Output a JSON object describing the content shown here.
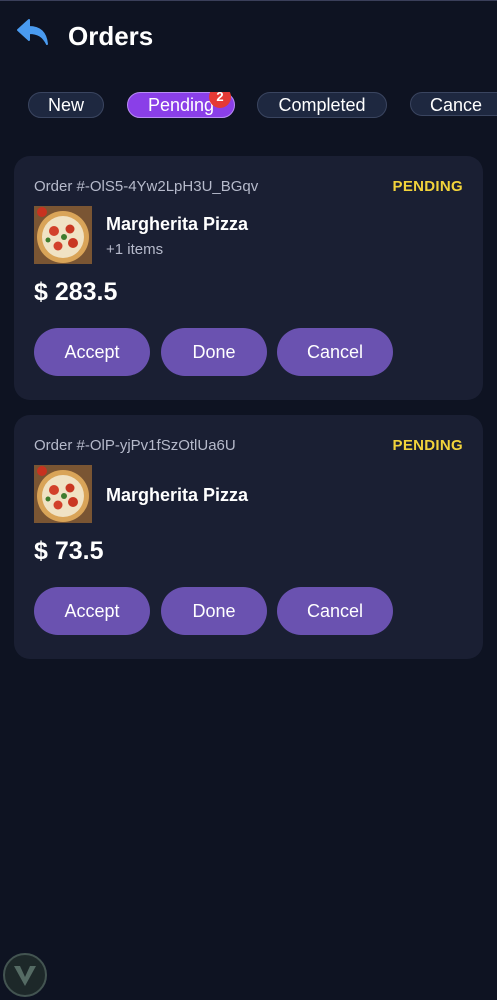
{
  "header": {
    "title": "Orders",
    "back_icon": "back-arrow-icon"
  },
  "tabs": [
    {
      "label": "New",
      "active": false
    },
    {
      "label": "Pending",
      "active": true,
      "badge": "2"
    },
    {
      "label": "Completed",
      "active": false
    },
    {
      "label": "Cance",
      "active": false
    }
  ],
  "orders": [
    {
      "order_id": "Order #-OlS5-4Yw2LpH3U_BGqv",
      "status": "PENDING",
      "product_name": "Margherita Pizza",
      "extra_items": "+1 items",
      "price": "$ 283.5",
      "actions": {
        "accept": "Accept",
        "done": "Done",
        "cancel": "Cancel"
      }
    },
    {
      "order_id": "Order #-OlP-yjPv1fSzOtlUa6U",
      "status": "PENDING",
      "product_name": "Margherita Pizza",
      "extra_items": "",
      "price": "$ 73.5",
      "actions": {
        "accept": "Accept",
        "done": "Done",
        "cancel": "Cancel"
      }
    }
  ],
  "colors": {
    "background": "#0e1322",
    "card": "#1a1f33",
    "accent_tab": "#8a3fe8",
    "button": "#6a52b0",
    "status_pending": "#f2d33b",
    "badge": "#e53935",
    "back_arrow": "#4a9bf0"
  }
}
